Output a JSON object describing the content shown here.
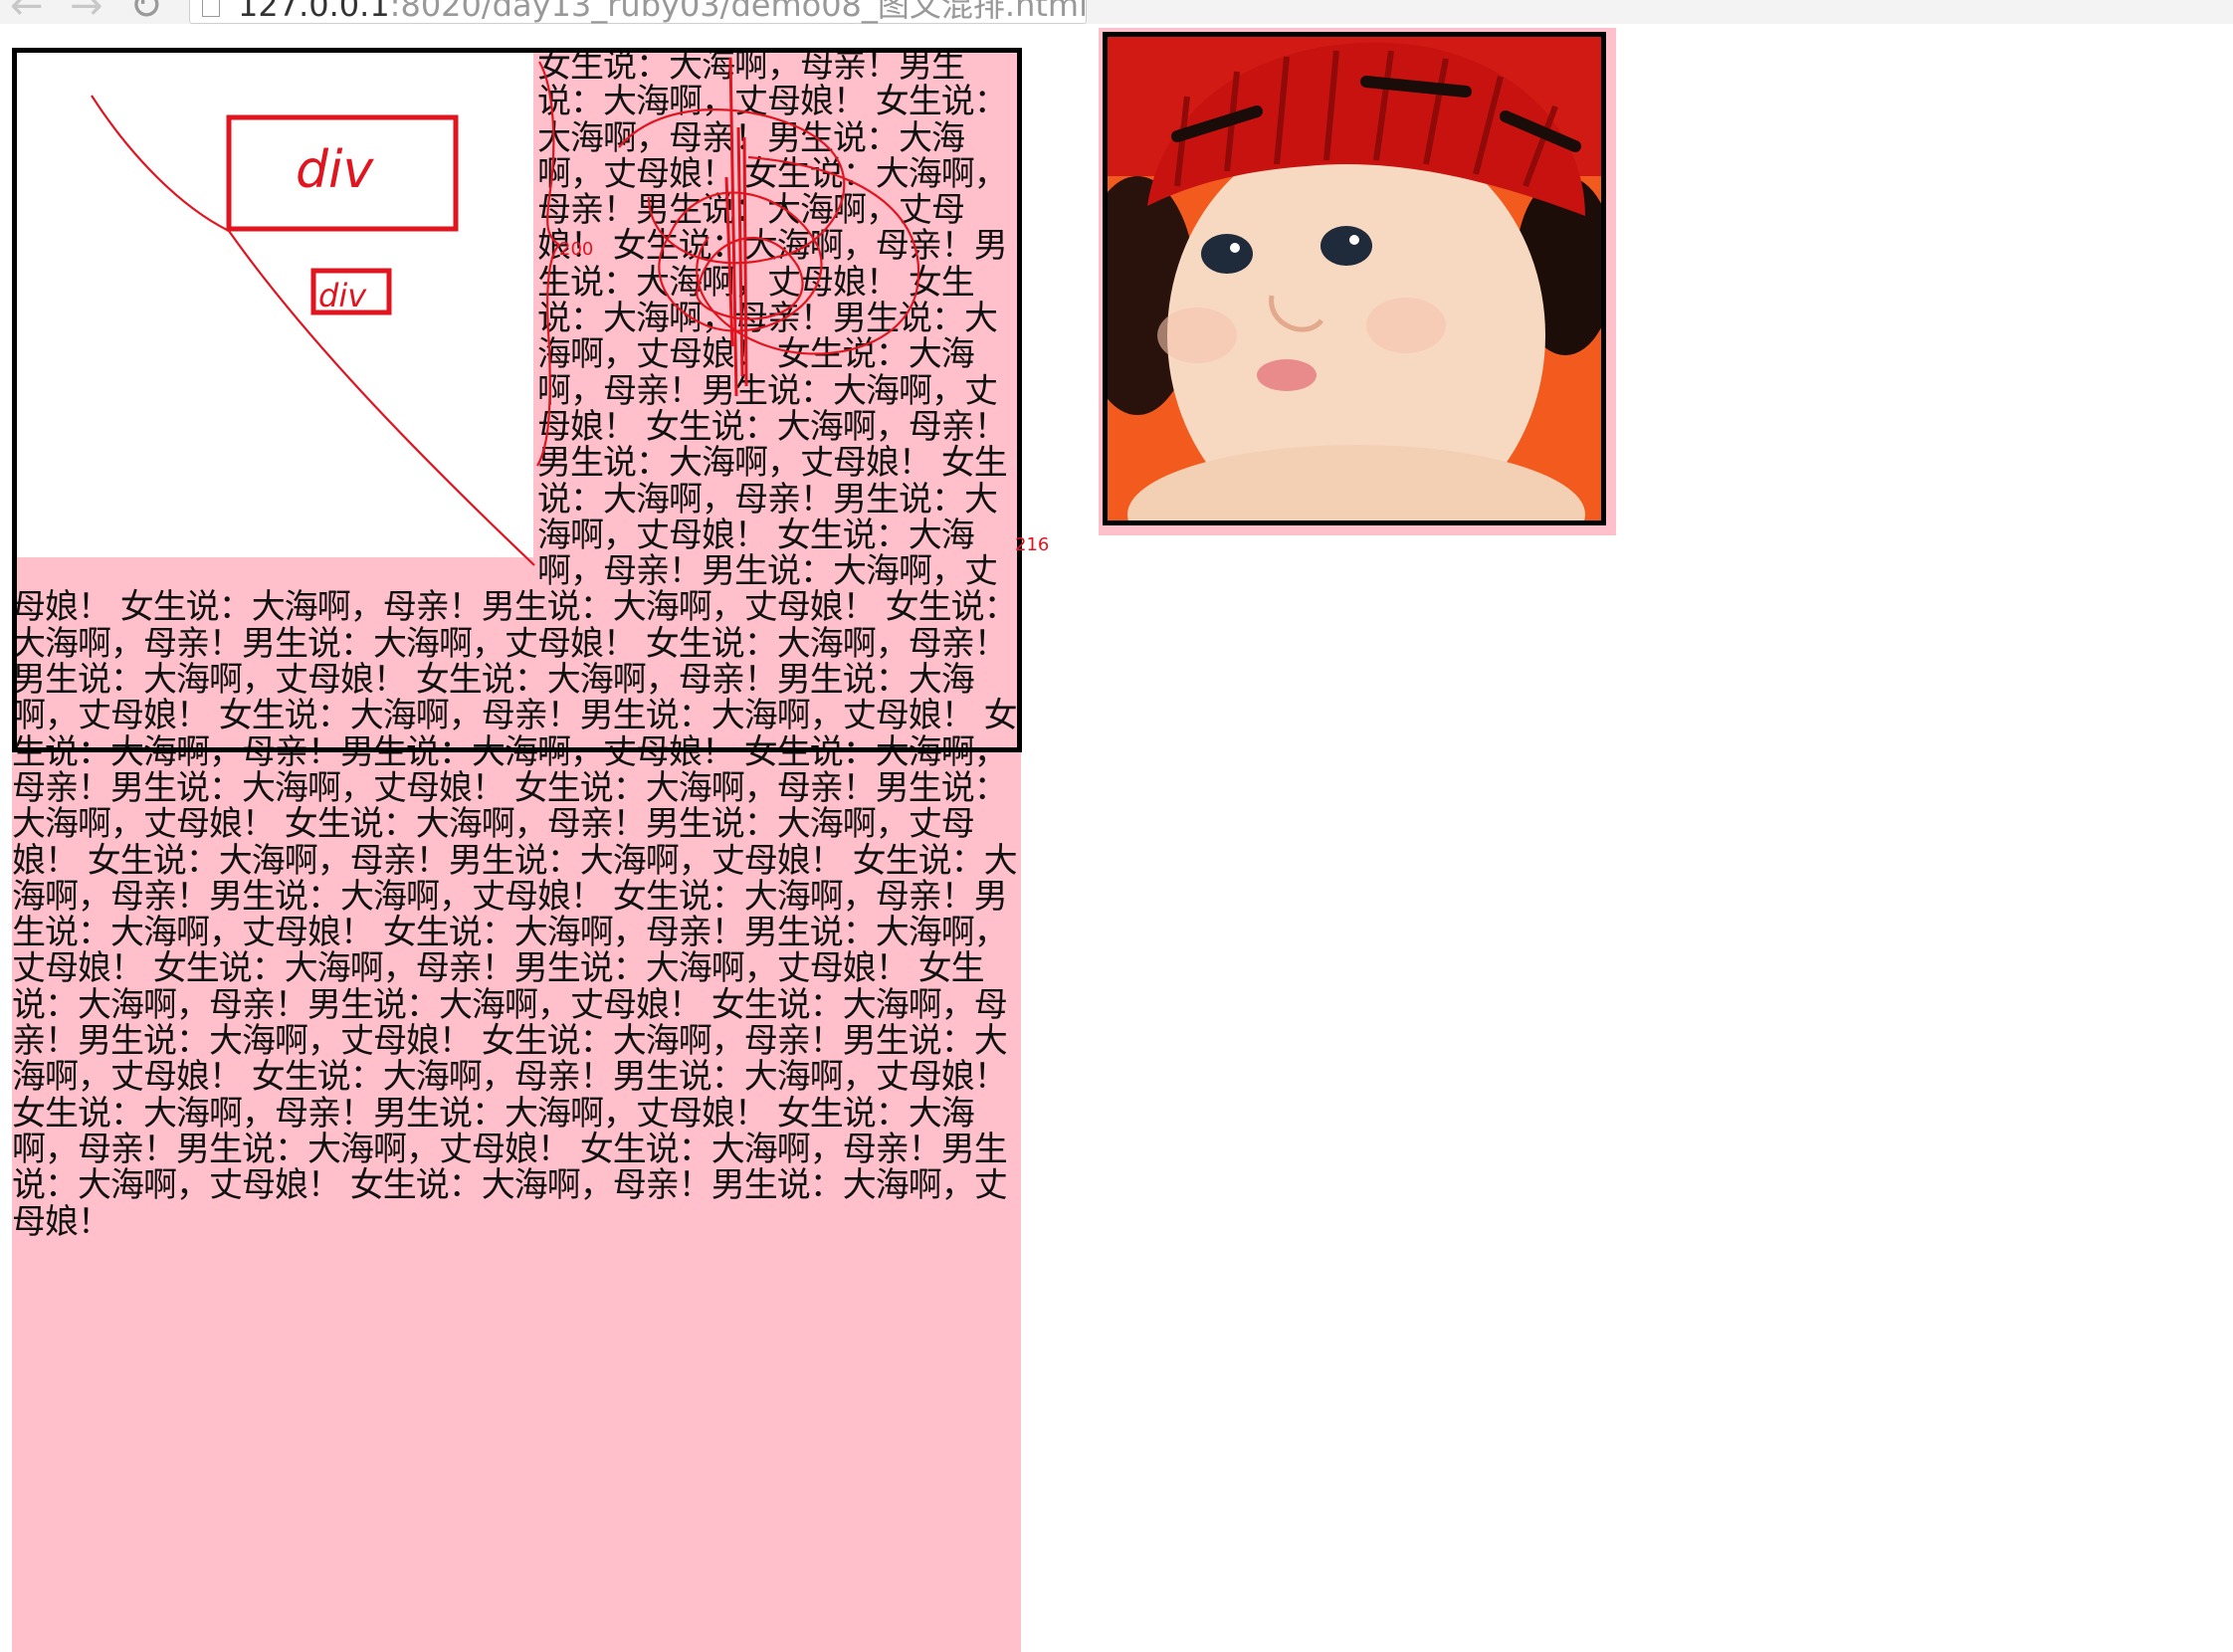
{
  "browser": {
    "url_host": "127.0.0.1",
    "url_path": ":8020/day13_ruby03/demo08_图文混排.html"
  },
  "scribbles": {
    "box1_label": "div",
    "box2_label": "div",
    "dim_a": "200",
    "dim_b": "216"
  },
  "content": {
    "mixed_text": "女生说：大海啊，母亲！男生说：大海啊，丈母娘！ 女生说：大海啊，母亲！男生说：大海啊，丈母娘！ 女生说：大海啊，母亲！男生说：大海啊，丈母娘！ 女生说：大海啊，母亲！男生说：大海啊，丈母娘！ 女生说：大海啊，母亲！男生说：大海啊，丈母娘！ 女生说：大海啊，母亲！男生说：大海啊，丈母娘！ 女生说：大海啊，母亲！男生说：大海啊，丈母娘！ 女生说：大海啊，母亲！男生说：大海啊，丈母娘！ 女生说：大海啊，母亲！男生说：大海啊，丈母娘！ 女生说：大海啊，母亲！男生说：大海啊，丈母娘！ 女生说：大海啊，母亲！男生说：大海啊，丈母娘！ 女生说：大海啊，母亲！男生说：大海啊，丈母娘！ 女生说：大海啊，母亲！男生说：大海啊，丈母娘！ 女生说：大海啊，母亲！男生说：大海啊，丈母娘！ 女生说：大海啊，母亲！男生说：大海啊，丈母娘！ 女生说：大海啊，母亲！男生说：大海啊，丈母娘！ 女生说：大海啊，母亲！男生说：大海啊，丈母娘！ 女生说：大海啊，母亲！男生说：大海啊，丈母娘！ 女生说：大海啊，母亲！男生说：大海啊，丈母娘！ 女生说：大海啊，母亲！男生说：大海啊，丈母娘！ 女生说：大海啊，母亲！男生说：大海啊，丈母娘！ 女生说：大海啊，母亲！男生说：大海啊，丈母娘！ 女生说：大海啊，母亲！男生说：大海啊，丈母娘！ 女生说：大海啊，母亲！男生说：大海啊，丈母娘！ 女生说：大海啊，母亲！男生说：大海啊，丈母娘！ 女生说：大海啊，母亲！男生说：大海啊，丈母娘！ 女生说：大海啊，母亲！男生说：大海啊，丈母娘！ 女生说：大海啊，母亲！男生说：大海啊，丈母娘！ 女生说：大海啊，母亲！男生说：大海啊，丈母娘！ 女生说：大海啊，母亲！男生说：大海啊，丈母娘！ 女生说：大海啊，母亲！男生说：大海啊，丈母娘！"
  },
  "colors": {
    "box_background": "#ffc0cb",
    "float_background": "#ffffff",
    "outline": "#000000",
    "annotation": "#e0151f"
  }
}
